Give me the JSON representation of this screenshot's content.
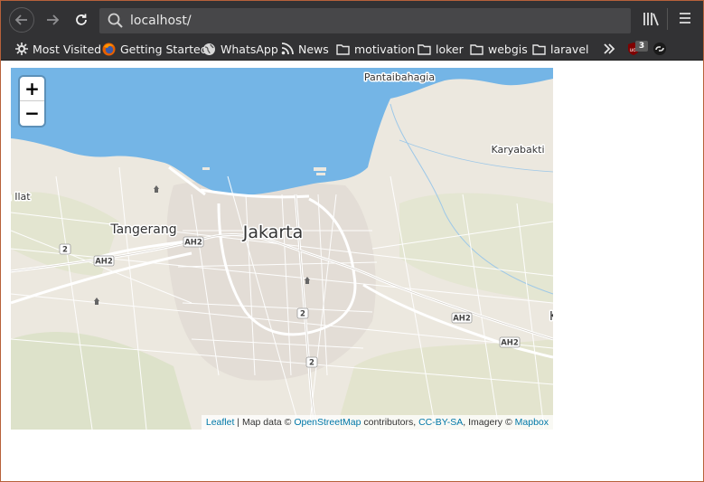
{
  "browser": {
    "url": "localhost/",
    "bookmarks": [
      {
        "label": "Most Visited",
        "icon": "gear-icon"
      },
      {
        "label": "Getting Started",
        "icon": "firefox-icon"
      },
      {
        "label": "WhatsApp",
        "icon": "globe-icon"
      },
      {
        "label": "News",
        "icon": "rss-icon"
      },
      {
        "label": "motivation",
        "icon": "folder-icon"
      },
      {
        "label": "loker",
        "icon": "folder-icon"
      },
      {
        "label": "webgis",
        "icon": "folder-icon"
      },
      {
        "label": "laravel",
        "icon": "folder-icon"
      }
    ],
    "extension_badge": "3"
  },
  "map": {
    "zoom_in_label": "+",
    "zoom_out_label": "−",
    "places": {
      "jakarta": "Jakarta",
      "tangerang": "Tangerang",
      "pantaibahagia": "Pantaibahagia",
      "karyabakti": "Karyabakti",
      "ilat": "a Ilat",
      "edge_k": "K"
    },
    "shields": {
      "ah2": "AH2",
      "two": "2"
    },
    "attribution": {
      "leaflet": "Leaflet",
      "sep1": " | Map data © ",
      "osm": "OpenStreetMap",
      "contrib": " contributors, ",
      "license": "CC-BY-SA",
      "imagery": ", Imagery © ",
      "mapbox": "Mapbox"
    },
    "colors": {
      "sea": "#74b5e6",
      "land": "#ece8df",
      "green": "#d6dfc1",
      "road": "#ffffff",
      "urban": "#e2dcd6"
    }
  }
}
